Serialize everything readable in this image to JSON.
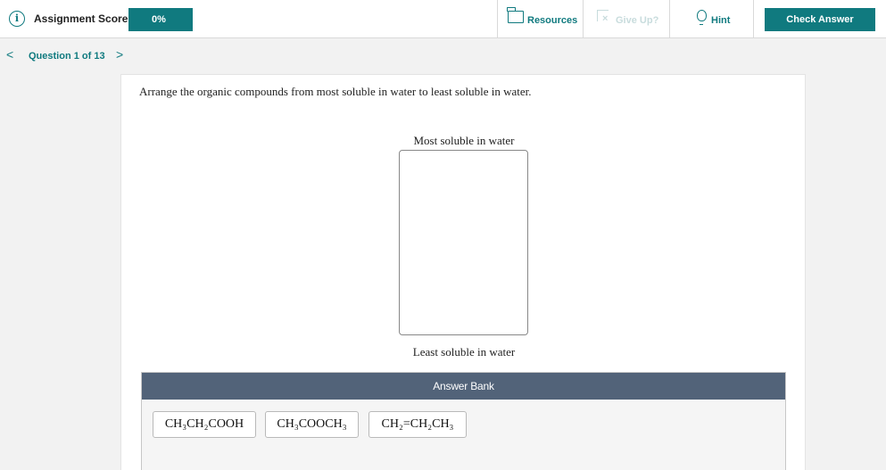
{
  "header": {
    "score_label": "Assignment Score:",
    "score_value": "0%",
    "resources_label": "Resources",
    "giveup_label": "Give Up?",
    "hint_label": "Hint",
    "check_label": "Check Answer"
  },
  "nav": {
    "prev": "<",
    "question_label": "Question 1 of 13",
    "next": ">"
  },
  "question": {
    "prompt": "Arrange the organic compounds from most soluble in water to least soluble in water.",
    "top_label": "Most soluble in water",
    "bottom_label": "Least soluble in water"
  },
  "bank": {
    "title": "Answer Bank",
    "items": [
      "CH₃CH₂COOH",
      "CH₃COOCH₃",
      "CH₂=CH₂CH₃"
    ]
  },
  "colors": {
    "accent": "#107a7f",
    "bank_header": "#526379",
    "disabled": "#c8dcdd"
  },
  "icons": {
    "info": "info-icon",
    "resources": "folder-icon",
    "giveup": "giveup-icon",
    "hint": "lightbulb-icon"
  }
}
